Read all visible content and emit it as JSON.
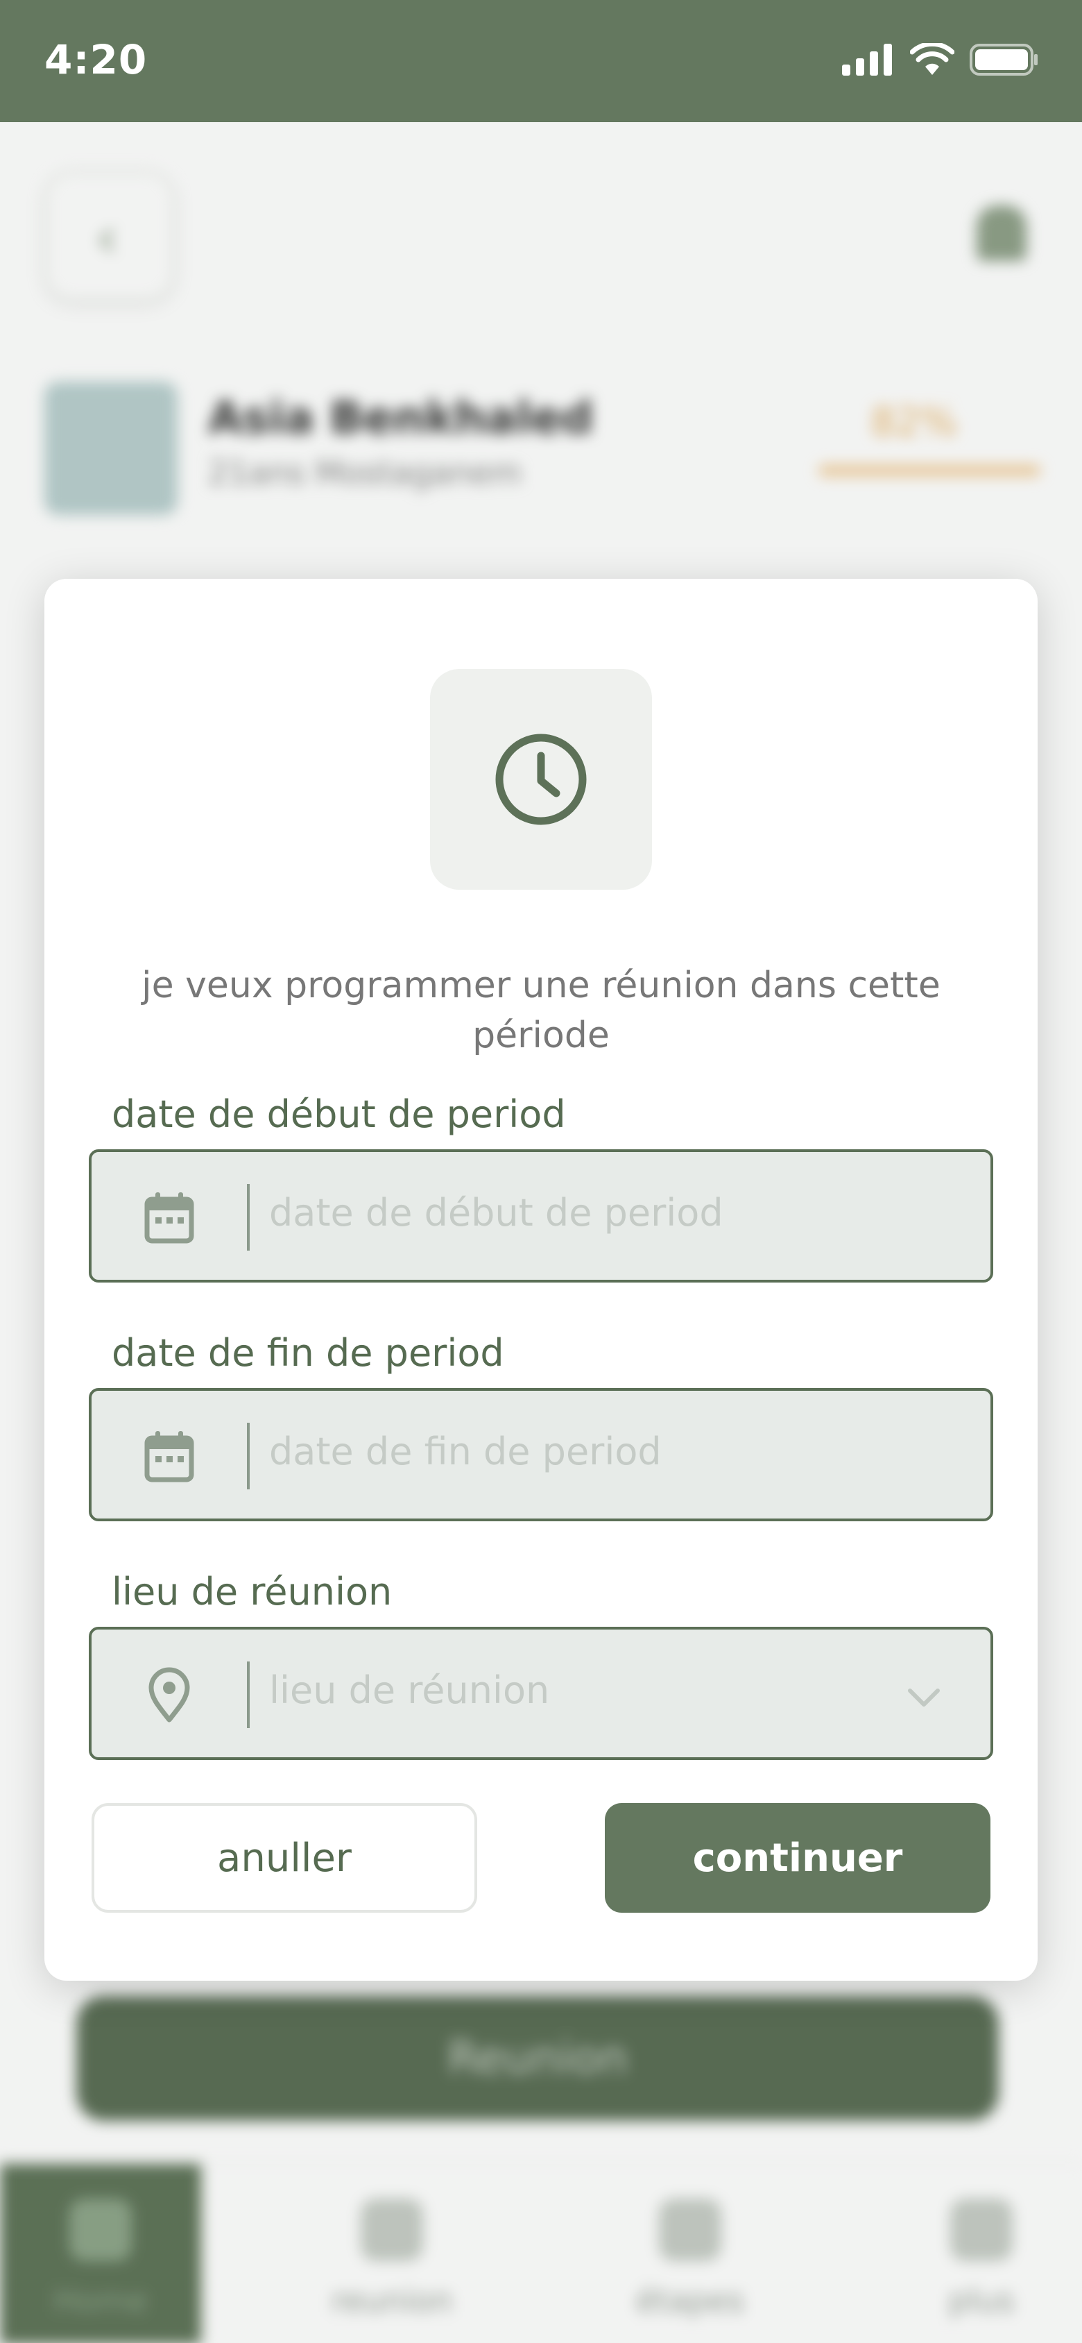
{
  "status_bar": {
    "time": "4:20"
  },
  "background": {
    "profile_name": "Asia Benkhaled",
    "profile_sub": "21ans Mostaganem",
    "percent": "82%",
    "reunion_button": "Reunion",
    "nav": [
      {
        "label": "Home"
      },
      {
        "label": "reunion"
      },
      {
        "label": "étapes"
      },
      {
        "label": "plus"
      }
    ]
  },
  "modal": {
    "message": "je veux programmer une réunion dans cette période",
    "start_label": "date de début de period",
    "start_placeholder": "date de début de period",
    "end_label": "date de fin de period",
    "end_placeholder": "date de fin de period",
    "place_label": "lieu de réunion",
    "place_placeholder": "lieu de réunion",
    "cancel_label": "anuller",
    "continue_label": "continuer"
  },
  "colors": {
    "primary": "#64785f",
    "field_bg": "#e7ebe8",
    "label": "#566b51"
  },
  "icons": [
    "clock-icon",
    "calendar-icon",
    "location-pin-icon",
    "chevron-down-icon",
    "signal-icon",
    "wifi-icon",
    "battery-icon"
  ]
}
